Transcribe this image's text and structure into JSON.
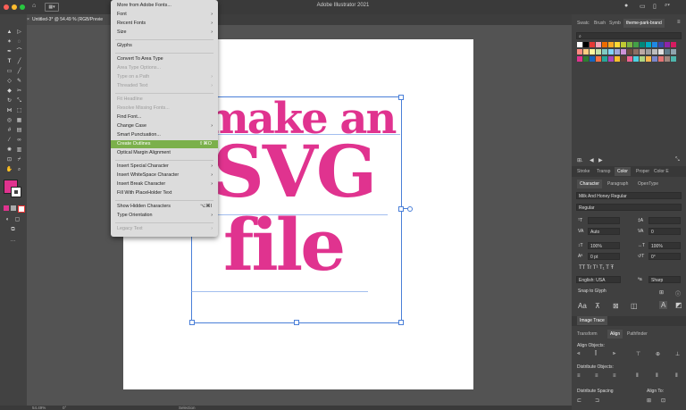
{
  "app_title": "Adobe Illustrator 2021",
  "document_tab": "Untitled-3* @ 54.49 % (RGB/Previe",
  "menu": {
    "items": [
      {
        "label": "More from Adobe Fonts...",
        "state": "normal",
        "submenu": false,
        "shortcut": ""
      },
      {
        "label": "Font",
        "state": "normal",
        "submenu": true,
        "shortcut": ""
      },
      {
        "label": "Recent Fonts",
        "state": "normal",
        "submenu": true,
        "shortcut": ""
      },
      {
        "label": "Size",
        "state": "normal",
        "submenu": true,
        "shortcut": ""
      },
      {
        "label": "Glyphs",
        "state": "normal",
        "submenu": false,
        "shortcut": ""
      },
      {
        "label": "Convert To Area Type",
        "state": "normal",
        "submenu": false,
        "shortcut": ""
      },
      {
        "label": "Area Type Options...",
        "state": "disabled",
        "submenu": false,
        "shortcut": ""
      },
      {
        "label": "Type on a Path",
        "state": "disabled",
        "submenu": true,
        "shortcut": ""
      },
      {
        "label": "Threaded Text",
        "state": "disabled",
        "submenu": true,
        "shortcut": ""
      },
      {
        "label": "Fit Headline",
        "state": "disabled",
        "submenu": false,
        "shortcut": ""
      },
      {
        "label": "Resolve Missing Fonts...",
        "state": "disabled",
        "submenu": false,
        "shortcut": ""
      },
      {
        "label": "Find Font...",
        "state": "normal",
        "submenu": false,
        "shortcut": ""
      },
      {
        "label": "Change Case",
        "state": "normal",
        "submenu": true,
        "shortcut": ""
      },
      {
        "label": "Smart Punctuation...",
        "state": "normal",
        "submenu": false,
        "shortcut": ""
      },
      {
        "label": "Create Outlines",
        "state": "highlighted",
        "submenu": false,
        "shortcut": "⇧⌘O"
      },
      {
        "label": "Optical Margin Alignment",
        "state": "normal",
        "submenu": false,
        "shortcut": ""
      },
      {
        "label": "Insert Special Character",
        "state": "normal",
        "submenu": true,
        "shortcut": ""
      },
      {
        "label": "Insert WhiteSpace Character",
        "state": "normal",
        "submenu": true,
        "shortcut": ""
      },
      {
        "label": "Insert Break Character",
        "state": "normal",
        "submenu": true,
        "shortcut": ""
      },
      {
        "label": "Fill With PlaceHolder Text",
        "state": "normal",
        "submenu": false,
        "shortcut": ""
      },
      {
        "label": "Show Hidden Characters",
        "state": "normal",
        "submenu": false,
        "shortcut": "⌥⌘I"
      },
      {
        "label": "Type Orientation",
        "state": "normal",
        "submenu": true,
        "shortcut": ""
      },
      {
        "label": "Legacy Text",
        "state": "disabled",
        "submenu": true,
        "shortcut": ""
      }
    ]
  },
  "artboard_text": {
    "line1": "make an",
    "line2": "SVG",
    "line3": "file",
    "color": "#e0338f"
  },
  "status": {
    "zoom": "54.49%",
    "rotation": "0°",
    "mode": "Selection"
  },
  "swatches_panel": {
    "tabs": [
      "Swatc",
      "Brush",
      "Symb",
      "theme-park-brand"
    ],
    "colors": [
      "#ffffff",
      "#000000",
      "#e53935",
      "#f4a3b4",
      "#ef6c00",
      "#f9a825",
      "#fdd835",
      "#c0ca33",
      "#7cb342",
      "#43a047",
      "#00897b",
      "#00acc1",
      "#1e88e5",
      "#3949ab",
      "#8e24aa",
      "#d81b60",
      "#ff8a80",
      "#ffcc80",
      "#fff59d",
      "#c5e1a5",
      "#80cbc4",
      "#81d4fa",
      "#9fa8da",
      "#ce93d8",
      "#6d4c41",
      "#8d6e63",
      "#bcaaa4",
      "#9e9e9e",
      "#bdbdbd",
      "#e0e0e0",
      "#607d8b",
      "#90a4ae",
      "#e0338f",
      "#2e7d32",
      "#1565c0",
      "#ff7043",
      "#26a69a",
      "#ab47bc",
      "#fbc02d",
      "#5d4037",
      "#f06292",
      "#4dd0e1",
      "#aed581",
      "#ffb74d",
      "#7986cb",
      "#e57373",
      "#a1887f",
      "#4db6ac"
    ]
  },
  "color_tabs": [
    "Stroke",
    "Transp",
    "Color",
    "Proper",
    "Color E"
  ],
  "character_panel": {
    "tabs": [
      "Character",
      "Paragraph",
      "OpenType"
    ],
    "font_family": "Milk And Honey Regular",
    "font_style": "Regular",
    "size": "",
    "leading": "Auto",
    "tracking": "0",
    "kerning": "",
    "vscale": "100%",
    "hscale": "100%",
    "baseline": "0 pt",
    "rotate": "0°",
    "language": "English: USA",
    "aa": "Sharp",
    "snap_label": "Snap to Glyph"
  },
  "image_trace_label": "Image Trace",
  "align_panel": {
    "tabs": [
      "Transform",
      "Align",
      "Pathfinder"
    ],
    "align_objects": "Align Objects:",
    "distribute_objects": "Distribute Objects:",
    "distribute_spacing": "Distribute Spacing",
    "align_to": "Align To:"
  }
}
